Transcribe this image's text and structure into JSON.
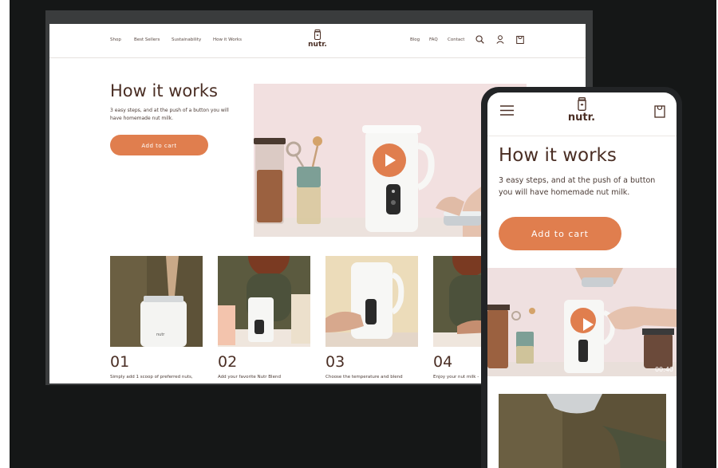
{
  "desktop": {
    "nav": {
      "left_links": [
        "Shop",
        "Best Sellers",
        "Sustainability",
        "How it Works"
      ],
      "right_links": [
        "Blog",
        "FAQ",
        "Contact"
      ],
      "logo_text": "nutr."
    },
    "hero": {
      "title": "How it works",
      "subtitle": "3 easy steps, and at the push of a button you will have homemade nut milk.",
      "cta_label": "Add to cart"
    },
    "steps": [
      {
        "number": "01",
        "text": "Simply add 1 scoop of preferred nuts,"
      },
      {
        "number": "02",
        "text": "Add your favorite Nutr Blend"
      },
      {
        "number": "03",
        "text": "Choose the temperature and blend"
      },
      {
        "number": "04",
        "text": "Enjoy your nut milk -"
      }
    ],
    "machine_label": "nutr"
  },
  "mobile": {
    "logo_text": "nutr.",
    "title": "How it works",
    "subtitle": "3 easy steps, and at the push of a button you will have homemade nut milk.",
    "cta_label": "Add to cart",
    "video_time": "00:40"
  },
  "icons": {
    "desktop": [
      "search-icon",
      "account-icon",
      "cart-icon",
      "play-icon"
    ],
    "mobile": [
      "menu-icon",
      "cart-icon",
      "play-icon"
    ]
  },
  "colors": {
    "accent": "#e07e4e",
    "text_dark": "#4a2e24",
    "backdrop": "#151717",
    "hero_bg": "#f1dfdf"
  }
}
